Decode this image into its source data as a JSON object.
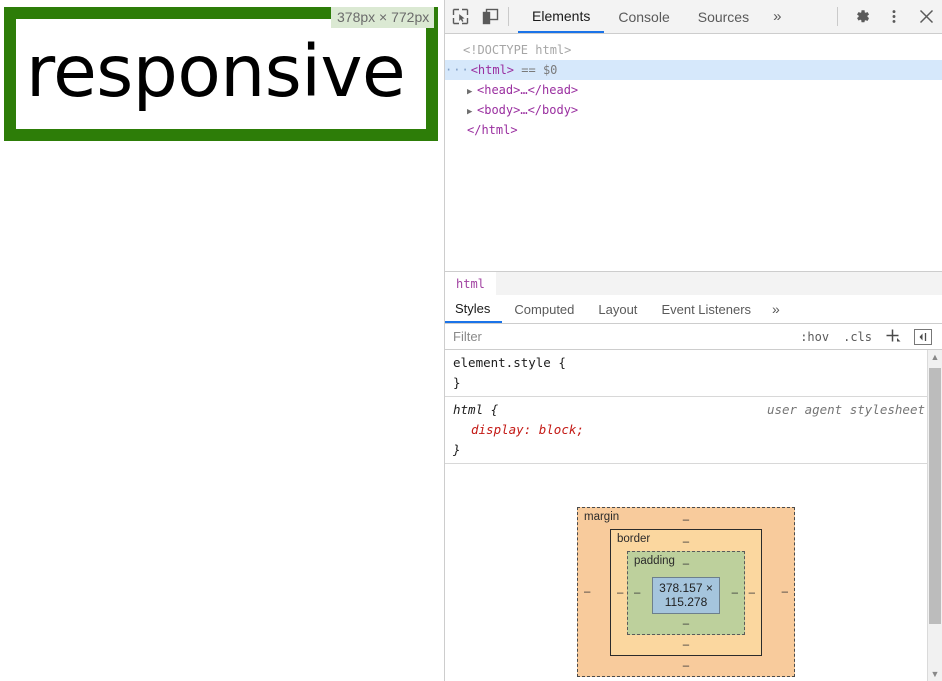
{
  "page": {
    "headline": "responsive",
    "size_badge": "378px × 772px",
    "box_border_color": "#2d7d08"
  },
  "devtools": {
    "toolbar": {
      "inspect_icon": "inspect-element-icon",
      "device_icon": "device-toolbar-icon",
      "tabs": [
        {
          "label": "Elements",
          "active": true
        },
        {
          "label": "Console",
          "active": false
        },
        {
          "label": "Sources",
          "active": false
        }
      ],
      "more_tabs": "»",
      "settings_icon": "gear-icon",
      "menu_icon": "kebab-menu-icon",
      "close_icon": "close-icon",
      "accent_color": "#1a73e8"
    },
    "dom": {
      "rows": [
        {
          "text": "<!DOCTYPE html>"
        },
        {
          "text": "<html> == $0"
        },
        {
          "text": "<head>…</head>"
        },
        {
          "text": "<body>…</body>"
        },
        {
          "text": "</html>"
        }
      ],
      "doctype": "<!DOCTYPE html>",
      "html_open": "<html>",
      "html_assign": "== $0",
      "head_node": "<head>…</head>",
      "body_node": "<body>…</body>",
      "html_close": "</html>",
      "selected_row": "<html> == $0"
    },
    "breadcrumb": {
      "items": [
        "html"
      ]
    },
    "styles_tabs": [
      {
        "label": "Styles",
        "active": true
      },
      {
        "label": "Computed",
        "active": false
      },
      {
        "label": "Layout",
        "active": false
      },
      {
        "label": "Event Listeners",
        "active": false
      }
    ],
    "styles_more": "»",
    "filter": {
      "placeholder": "Filter",
      "value": "",
      "hov_label": ":hov",
      "cls_label": ".cls",
      "new_rule_label": "+",
      "toggle_pane_label": "◀"
    },
    "rules": [
      {
        "selector": "element.style {",
        "origin": "",
        "declarations": [],
        "close": "}"
      },
      {
        "selector": "html {",
        "origin": "user agent stylesheet",
        "declarations": [
          {
            "name": "display",
            "value": "block;"
          }
        ],
        "close": "}"
      }
    ],
    "box_model": {
      "margin_label": "margin",
      "border_label": "border",
      "padding_label": "padding",
      "content_size": "378.157 × 115.278",
      "dash": "‒",
      "colors": {
        "margin": "#f8cb9c",
        "border": "#fbd79f",
        "padding": "#bdd09c",
        "content": "#a5c5dd"
      }
    }
  }
}
